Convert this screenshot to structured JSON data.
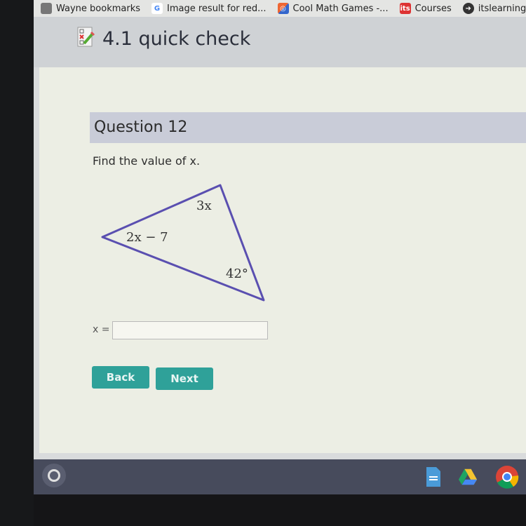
{
  "bookmarks": [
    {
      "label": "Wayne bookmarks",
      "icon": "folder-icon"
    },
    {
      "label": "Image result for red...",
      "icon": "google-icon"
    },
    {
      "label": "Cool Math Games -...",
      "icon": "coolmath-icon"
    },
    {
      "label": "Courses",
      "icon": "its-icon"
    },
    {
      "label": "itslearning",
      "icon": "itslearning-icon"
    }
  ],
  "header": {
    "title": "4.1 quick check",
    "icon": "quiz-icon"
  },
  "question": {
    "title": "Question 12",
    "prompt": "Find the value of x.",
    "figure": {
      "shape": "triangle",
      "angle_labels": [
        "3x",
        "2x − 7",
        "42°"
      ]
    },
    "answer_label": "x =",
    "answer_value": ""
  },
  "buttons": {
    "back": "Back",
    "next": "Next"
  },
  "colors": {
    "accent": "#2fa199",
    "triangle_stroke": "#5a4fb0",
    "question_bar": "#c9ccd8"
  },
  "taskbar": {
    "apps": [
      "docs-icon",
      "drive-icon",
      "chrome-icon"
    ]
  }
}
